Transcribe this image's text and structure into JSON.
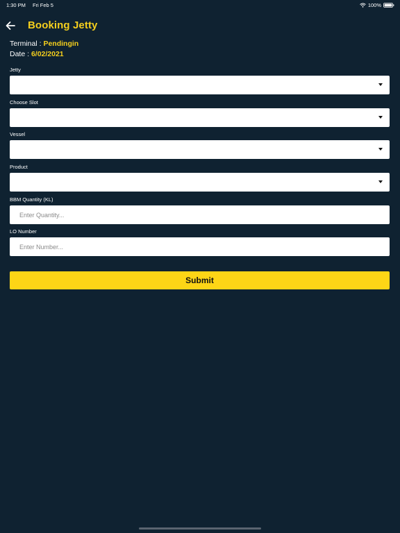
{
  "status_bar": {
    "time": "1:30 PM",
    "date": "Fri Feb 5",
    "battery": "100%"
  },
  "header": {
    "title": "Booking Jetty"
  },
  "info": {
    "terminal_label": "Terminal : ",
    "terminal_value": "Pendingin",
    "date_label": "Date : ",
    "date_value": "6/02/2021"
  },
  "form": {
    "jetty_label": "Jetty",
    "slot_label": "Choose Slot",
    "vessel_label": "Vessel",
    "product_label": "Product",
    "quantity_label": "BBM Quantity (KL)",
    "quantity_placeholder": "Enter Quantity...",
    "lo_label": "LO Number",
    "lo_placeholder": "Enter Number...",
    "submit_label": "Submit"
  },
  "colors": {
    "background": "#0f2231",
    "accent": "#f5cf1d",
    "button": "#fdd516"
  }
}
